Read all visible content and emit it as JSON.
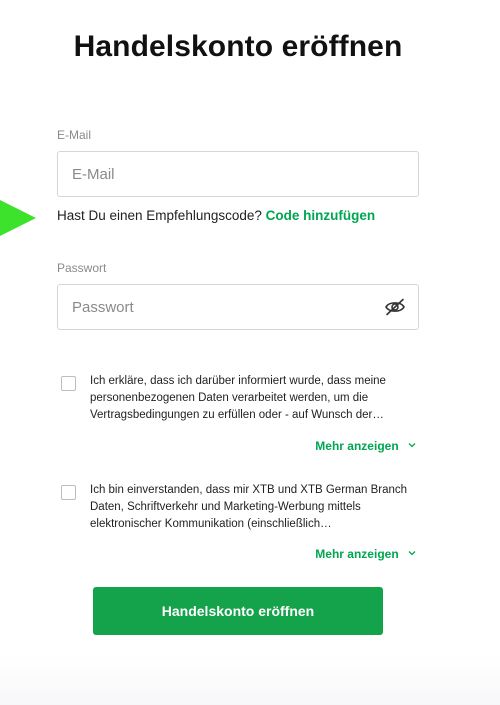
{
  "page": {
    "title": "Handelskonto eröffnen"
  },
  "email": {
    "label": "E-Mail",
    "placeholder": "E-Mail",
    "value": ""
  },
  "referral": {
    "question": "Hast Du einen Empfehlungscode?",
    "link": "Code hinzufügen"
  },
  "password": {
    "label": "Passwort",
    "placeholder": "Passwort",
    "value": "",
    "toggle_icon": "eye-slash-icon"
  },
  "consents": [
    {
      "text": "Ich erkläre, dass ich darüber informiert wurde, dass meine personenbezogenen Daten verarbeitet werden, um die Vertragsbedingungen zu erfüllen oder - auf Wunsch der…",
      "more_label": "Mehr anzeigen",
      "checked": false
    },
    {
      "text": "Ich bin einverstanden, dass mir XTB und XTB German Branch Daten, Schriftverkehr und Marketing-Werbung mittels elektronischer Kommunikation (einschließlich…",
      "more_label": "Mehr anzeigen",
      "checked": false
    }
  ],
  "submit": {
    "label": "Handelskonto eröffnen"
  },
  "colors": {
    "accent": "#00a651",
    "button": "#14a34a",
    "arrow": "#3de22c"
  }
}
